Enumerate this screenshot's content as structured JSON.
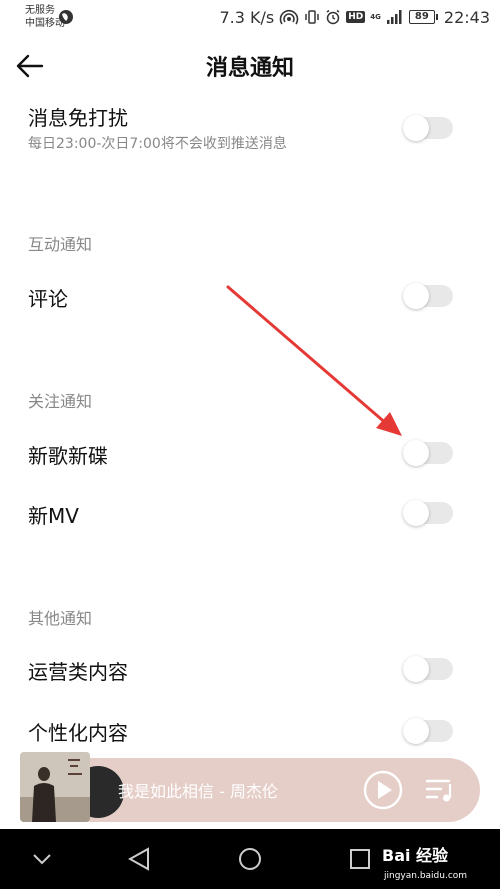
{
  "status_bar": {
    "carrier_line1": "无服务",
    "carrier_line2": "中国移动",
    "network_speed": "7.3 K/s",
    "hd": "HD",
    "net_type": "4G",
    "battery": "89",
    "time": "22:43"
  },
  "header": {
    "title": "消息通知"
  },
  "dnd": {
    "label": "消息免打扰",
    "description": "每日23:00-次日7:00将不会收到推送消息",
    "enabled": false
  },
  "sections": {
    "interaction": {
      "title": "互动通知",
      "items": [
        {
          "label": "评论",
          "enabled": false
        }
      ]
    },
    "follow": {
      "title": "关注通知",
      "items": [
        {
          "label": "新歌新碟",
          "enabled": false
        },
        {
          "label": "新MV",
          "enabled": false
        }
      ]
    },
    "other": {
      "title": "其他通知",
      "items": [
        {
          "label": "运营类内容",
          "enabled": false
        },
        {
          "label": "个性化内容",
          "enabled": false
        }
      ]
    }
  },
  "player": {
    "song": "我是如此相信 - 周杰伦"
  },
  "watermark": {
    "brand": "Bai 经验",
    "url": "jingyan.baidu.com"
  },
  "colors": {
    "toggle_off": "#e8e8e8",
    "annotation_arrow": "#e53935",
    "player_bg": "#e6cec8"
  }
}
